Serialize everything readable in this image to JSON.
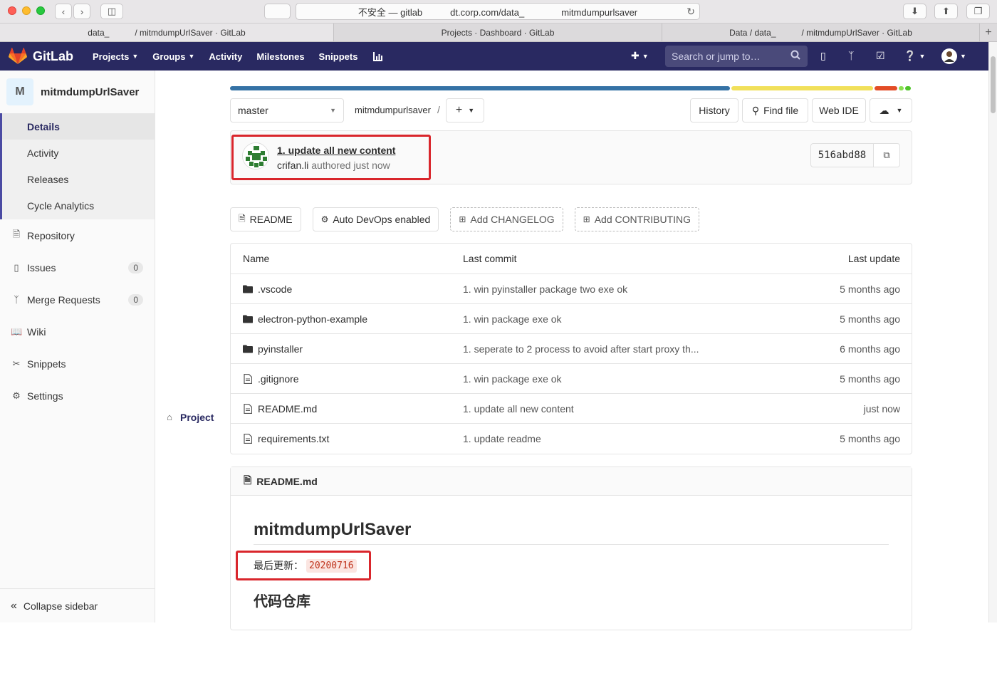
{
  "browser": {
    "address": "不安全 — gitlab   dt.corp.com/data_    mitmdumpurlsaver",
    "tabs": [
      {
        "label": "data_   / mitmdumpUrlSaver · GitLab",
        "active": true
      },
      {
        "label": "Projects · Dashboard · GitLab",
        "active": false
      },
      {
        "label": "Data / data_   / mitmdumpUrlSaver · GitLab",
        "active": false
      }
    ]
  },
  "navbar": {
    "brand": "GitLab",
    "items": [
      "Projects",
      "Groups",
      "Activity",
      "Milestones",
      "Snippets"
    ],
    "search_placeholder": "Search or jump to…"
  },
  "sidebar": {
    "avatar_letter": "M",
    "project_name": "mitmdumpUrlSaver",
    "project_label": "Project",
    "project_sub": [
      "Details",
      "Activity",
      "Releases",
      "Cycle Analytics"
    ],
    "items": [
      {
        "label": "Repository",
        "icon": "doc-icon"
      },
      {
        "label": "Issues",
        "icon": "issues-icon",
        "badge": "0"
      },
      {
        "label": "Merge Requests",
        "icon": "merge-icon",
        "badge": "0"
      },
      {
        "label": "Wiki",
        "icon": "book-icon"
      },
      {
        "label": "Snippets",
        "icon": "scissors-icon"
      },
      {
        "label": "Settings",
        "icon": "gear-icon"
      }
    ],
    "collapse": "Collapse sidebar"
  },
  "repo": {
    "language_bar": [
      {
        "color": "#3572A5",
        "fraction": 0.735
      },
      {
        "color": "#f1e05a",
        "fraction": 0.21
      },
      {
        "color": "#e34c26",
        "fraction": 0.036
      },
      {
        "color": "#89e051",
        "fraction": 0.009
      },
      {
        "color": "#4fc42a",
        "fraction": 0.01
      }
    ],
    "branch": "master",
    "path": "mitmdumpurlsaver",
    "path_sep": "/",
    "buttons": {
      "history": "History",
      "find_file": "Find file",
      "web_ide": "Web IDE"
    },
    "commit": {
      "title": "1. update all new content",
      "author": "crifan.li",
      "when": "authored just now",
      "sha": "516abd88"
    },
    "shortcuts": {
      "readme": "README",
      "autodevops": "Auto DevOps enabled",
      "changelog": "Add CHANGELOG",
      "contributing": "Add CONTRIBUTING"
    },
    "table": {
      "headers": {
        "name": "Name",
        "commit": "Last commit",
        "update": "Last update"
      },
      "rows": [
        {
          "type": "folder",
          "name": ".vscode",
          "commit": "1. win pyinstaller package two exe ok",
          "update": "5 months ago"
        },
        {
          "type": "folder",
          "name": "electron-python-example",
          "commit": "1. win package exe ok",
          "update": "5 months ago"
        },
        {
          "type": "folder",
          "name": "pyinstaller",
          "commit": "1. seperate to 2 process to avoid after start proxy th...",
          "update": "6 months ago"
        },
        {
          "type": "file",
          "name": ".gitignore",
          "commit": "1. win package exe ok",
          "update": "5 months ago"
        },
        {
          "type": "file",
          "name": "README.md",
          "commit": "1. update all new content",
          "update": "just now"
        },
        {
          "type": "file",
          "name": "requirements.txt",
          "commit": "1. update readme",
          "update": "5 months ago"
        }
      ]
    },
    "readme": {
      "file": "README.md",
      "title": "mitmdumpUrlSaver",
      "updated_label": "最后更新：",
      "updated_value": "20200716",
      "h2": "代码仓库"
    }
  }
}
